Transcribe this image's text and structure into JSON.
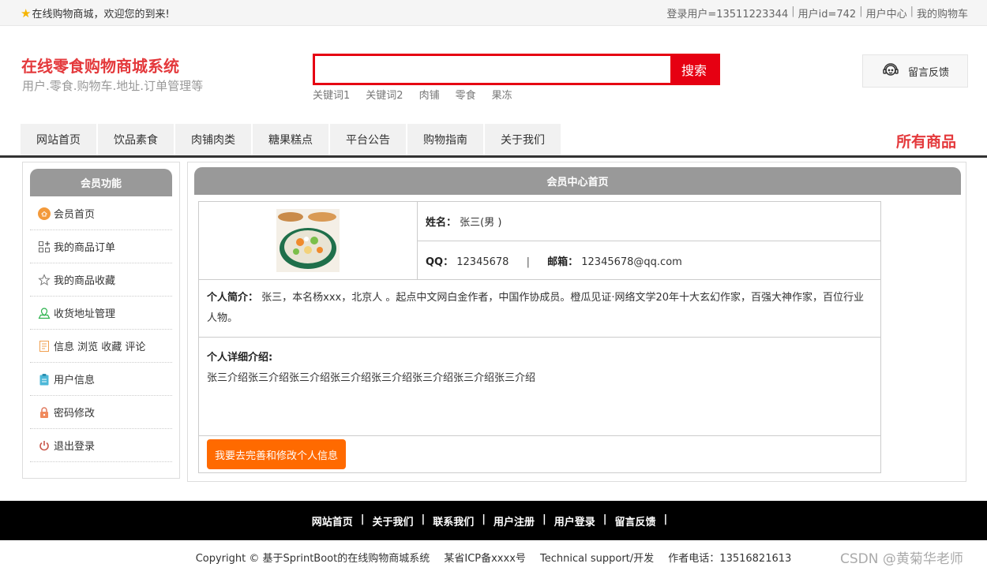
{
  "topbar": {
    "welcome": "在线购物商城，欢迎您的到来!",
    "login_user": "登录用户=13511223344",
    "user_id": "用户id=742",
    "user_center": "用户中心",
    "my_cart": "我的购物车",
    "sep": "|"
  },
  "header": {
    "title": "在线零食购物商城系统",
    "subtitle": "用户.零食.购物车.地址.订单管理等",
    "search_value": "",
    "search_button": "搜索",
    "hotwords": [
      "关键词1",
      "关键词2",
      "肉铺",
      "零食",
      "果冻"
    ],
    "feedback": "留言反馈"
  },
  "nav": {
    "items": [
      "网站首页",
      "饮品素食",
      "肉铺肉类",
      "糖果糕点",
      "平台公告",
      "购物指南",
      "关于我们"
    ],
    "all_goods": "所有商品"
  },
  "sidebar": {
    "title": "会员功能",
    "items": [
      {
        "label": "会员首页",
        "icon": "home-icon"
      },
      {
        "label": "我的商品订单",
        "icon": "grid-icon"
      },
      {
        "label": "我的商品收藏",
        "icon": "star-icon"
      },
      {
        "label": "收货地址管理",
        "icon": "location-icon"
      },
      {
        "label": "信息 浏览 收藏 评论",
        "icon": "document-icon"
      },
      {
        "label": "用户信息",
        "icon": "clipboard-icon"
      },
      {
        "label": "密码修改",
        "icon": "lock-icon"
      },
      {
        "label": "退出登录",
        "icon": "power-icon"
      }
    ]
  },
  "main": {
    "title": "会员中心首页",
    "name_label": "姓名：",
    "name_value": "张三(男 )",
    "qq_label": "QQ：",
    "qq_value": "12345678",
    "divider": "|",
    "email_label": "邮箱：",
    "email_value": "12345678@qq.com",
    "intro_label": "个人简介：",
    "intro_value": "张三，本名杨xxx，北京人 。起点中文网白金作者，中国作协成员。橙瓜见证·网络文学20年十大玄幻作家，百强大神作家，百位行业人物。",
    "detail_label": "个人详细介绍:",
    "detail_value": "张三介绍张三介绍张三介绍张三介绍张三介绍张三介绍张三介绍张三介绍",
    "edit_button": "我要去完善和修改个人信息"
  },
  "footer": {
    "links": [
      "网站首页",
      "关于我们",
      "联系我们",
      "用户注册",
      "用户登录",
      "留言反馈"
    ],
    "sep": "|",
    "copyright": "Copyright © 基于SprintBoot的在线购物商城系统",
    "icp": "某省ICP备xxxx号",
    "support": "Technical support/开发",
    "phone": "作者电话：13516821613",
    "watermark": "CSDN @黄菊华老师"
  },
  "colors": {
    "brand_red": "#e4393c",
    "search_red": "#e60012",
    "button_orange": "#ff6a00",
    "panel_header_gray": "#999999",
    "footer_black": "#000000"
  }
}
